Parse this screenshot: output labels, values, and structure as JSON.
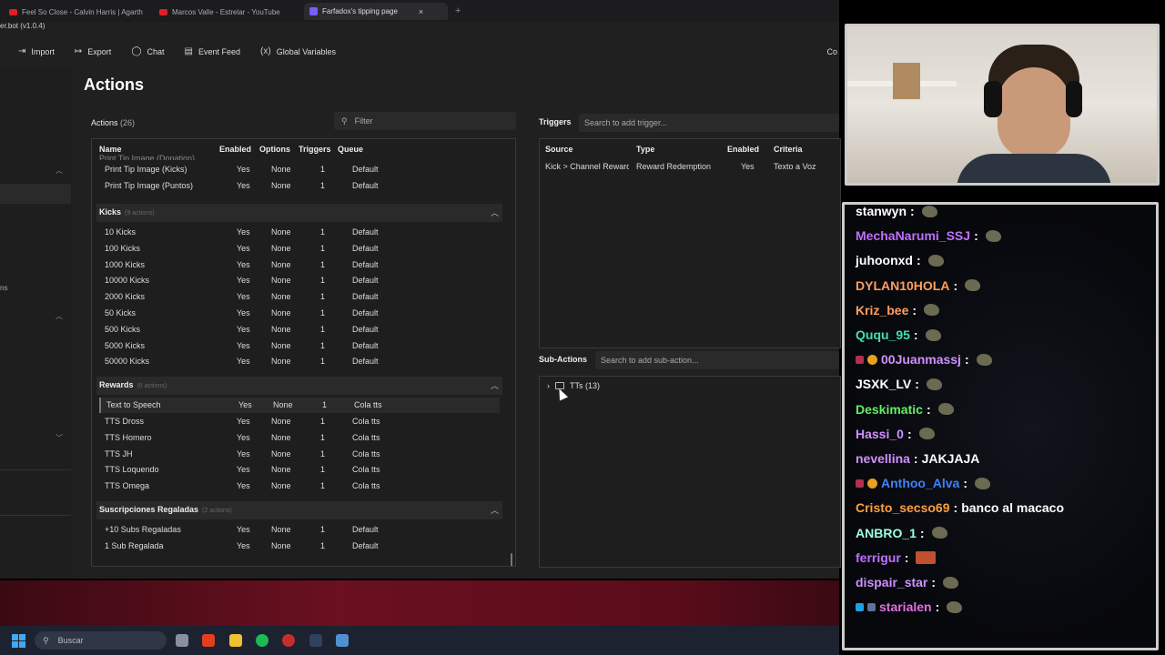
{
  "browser": {
    "tabs": [
      {
        "label": "Feel So Close - Calvin Harris | Agarth"
      },
      {
        "label": "Marcos Valle - Estrelar - YouTube"
      },
      {
        "label": "Farfadox's tipping page"
      }
    ],
    "close_glyph": "×",
    "new_tab_glyph": "+"
  },
  "app": {
    "title": "er.bot (v1.0.4)",
    "toolbar": {
      "import": "Import",
      "export": "Export",
      "chat": "Chat",
      "event_feed": "Event Feed",
      "global_variables": "Global Variables",
      "right_cut": "Co"
    },
    "sidebar_fragment": "ns",
    "page_title": "Actions",
    "actions_label": "Actions",
    "actions_count": "(26)",
    "filter_placeholder": "Filter",
    "columns": {
      "name": "Name",
      "enabled": "Enabled",
      "options": "Options",
      "triggers": "Triggers",
      "queue": "Queue"
    },
    "top_rows": [
      {
        "name": "Print Tip Image (Kicks)",
        "enabled": "Yes",
        "options": "None",
        "triggers": "1",
        "queue": "Default"
      },
      {
        "name": "Print Tip Image (Puntos)",
        "enabled": "Yes",
        "options": "None",
        "triggers": "1",
        "queue": "Default"
      }
    ],
    "scrolled_partial_row": "Print Tip Image (Donation)",
    "groups": [
      {
        "name": "Kicks",
        "count": "(9 actions)",
        "rows": [
          {
            "name": "10 Kicks",
            "enabled": "Yes",
            "options": "None",
            "triggers": "1",
            "queue": "Default"
          },
          {
            "name": "100 Kicks",
            "enabled": "Yes",
            "options": "None",
            "triggers": "1",
            "queue": "Default"
          },
          {
            "name": "1000 Kicks",
            "enabled": "Yes",
            "options": "None",
            "triggers": "1",
            "queue": "Default"
          },
          {
            "name": "10000 Kicks",
            "enabled": "Yes",
            "options": "None",
            "triggers": "1",
            "queue": "Default"
          },
          {
            "name": "2000 Kicks",
            "enabled": "Yes",
            "options": "None",
            "triggers": "1",
            "queue": "Default"
          },
          {
            "name": "50 Kicks",
            "enabled": "Yes",
            "options": "None",
            "triggers": "1",
            "queue": "Default"
          },
          {
            "name": "500 Kicks",
            "enabled": "Yes",
            "options": "None",
            "triggers": "1",
            "queue": "Default"
          },
          {
            "name": "5000 Kicks",
            "enabled": "Yes",
            "options": "None",
            "triggers": "1",
            "queue": "Default"
          },
          {
            "name": "50000 Kicks",
            "enabled": "Yes",
            "options": "None",
            "triggers": "1",
            "queue": "Default"
          }
        ]
      },
      {
        "name": "Rewards",
        "count": "(6 actions)",
        "rows": [
          {
            "name": "Text to Speech",
            "enabled": "Yes",
            "options": "None",
            "triggers": "1",
            "queue": "Cola tts"
          },
          {
            "name": "TTS Dross",
            "enabled": "Yes",
            "options": "None",
            "triggers": "1",
            "queue": "Cola tts"
          },
          {
            "name": "TTS Homero",
            "enabled": "Yes",
            "options": "None",
            "triggers": "1",
            "queue": "Cola tts"
          },
          {
            "name": "TTS JH",
            "enabled": "Yes",
            "options": "None",
            "triggers": "1",
            "queue": "Cola tts"
          },
          {
            "name": "TTS Loquendo",
            "enabled": "Yes",
            "options": "None",
            "triggers": "1",
            "queue": "Cola tts"
          },
          {
            "name": "TTS Omega",
            "enabled": "Yes",
            "options": "None",
            "triggers": "1",
            "queue": "Cola tts"
          }
        ]
      },
      {
        "name": "Suscripciones Regaladas",
        "count": "(2 actions)",
        "rows": [
          {
            "name": "+10 Subs Regaladas",
            "enabled": "Yes",
            "options": "None",
            "triggers": "1",
            "queue": "Default"
          },
          {
            "name": "1 Sub Regalada",
            "enabled": "Yes",
            "options": "None",
            "triggers": "1",
            "queue": "Default"
          }
        ]
      }
    ],
    "triggers": {
      "label": "Triggers",
      "search_placeholder": "Search to add trigger...",
      "columns": {
        "source": "Source",
        "type": "Type",
        "enabled": "Enabled",
        "criteria": "Criteria"
      },
      "row": {
        "source": "Kick > Channel Reward",
        "type": "Reward Redemption",
        "enabled": "Yes",
        "criteria": "Texto a Voz"
      }
    },
    "subactions": {
      "label": "Sub-Actions",
      "search_placeholder": "Search to add sub-action...",
      "folder": "TTs (13)"
    }
  },
  "taskbar": {
    "search_placeholder": "Buscar"
  },
  "chat": {
    "messages": [
      {
        "user": "stanwyn",
        "color": "#ffffff",
        "text": ""
      },
      {
        "user": "MechaNarumi_SSJ",
        "color": "#c070ff",
        "text": ""
      },
      {
        "user": "juhoonxd",
        "color": "#ffffff",
        "text": ""
      },
      {
        "user": "DYLAN10HOLA",
        "color": "#ff9f60",
        "text": ""
      },
      {
        "user": "Kriz_bee",
        "color": "#ff9f60",
        "text": ""
      },
      {
        "user": "Ququ_95",
        "color": "#40e0b0",
        "text": ""
      },
      {
        "user": "00Juanmassj",
        "color": "#d090ff",
        "text": ""
      },
      {
        "user": "JSXK_LV",
        "color": "#ffffff",
        "text": ""
      },
      {
        "user": "Deskimatic",
        "color": "#60f060",
        "text": ""
      },
      {
        "user": "Hassi_0",
        "color": "#d090ff",
        "text": ""
      },
      {
        "user": "nevellina",
        "color": "#d090ff",
        "text": "JAKJAJA"
      },
      {
        "user": "Anthoo_Alva",
        "color": "#4080ff",
        "text": ""
      },
      {
        "user": "Cristo_secso69",
        "color": "#ff9f40",
        "text": "banco al macaco"
      },
      {
        "user": "ANBRO_1",
        "color": "#a0ffe0",
        "text": ""
      },
      {
        "user": "ferrigur",
        "color": "#c070ff",
        "text": ""
      },
      {
        "user": "dispair_star",
        "color": "#d090ff",
        "text": ""
      },
      {
        "user": "starialen",
        "color": "#e070e0",
        "text": ""
      }
    ],
    "separator": ":"
  }
}
